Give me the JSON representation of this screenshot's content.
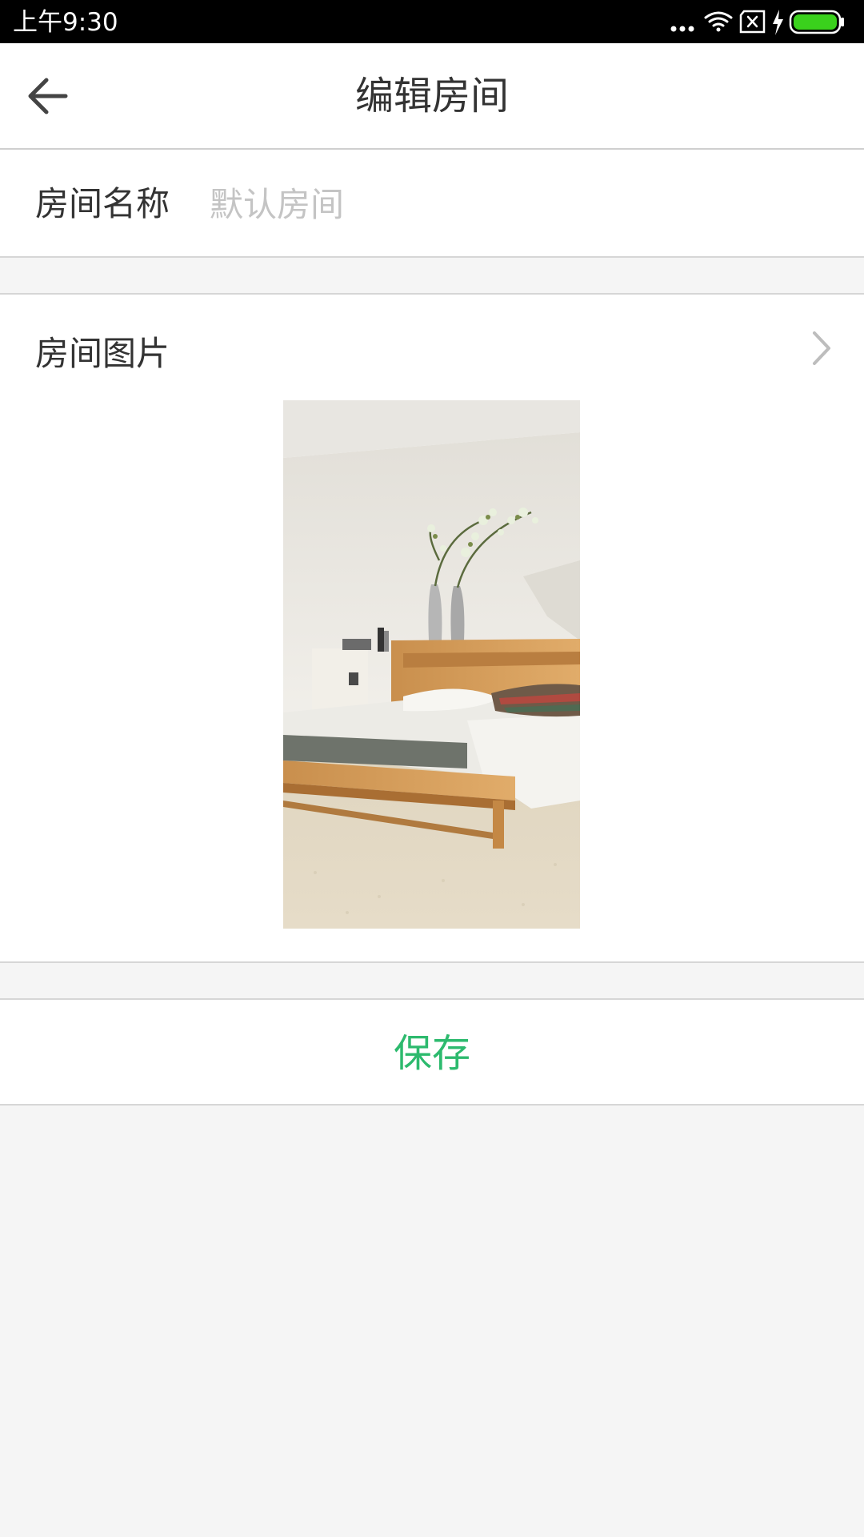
{
  "status_bar": {
    "time": "上午9:30",
    "icons": [
      "more-dots-icon",
      "wifi-icon",
      "sim-card-icon",
      "charging-icon",
      "battery-icon"
    ]
  },
  "app_bar": {
    "back_icon": "arrow-left-icon",
    "title": "编辑房间"
  },
  "room_name": {
    "label": "房间名称",
    "value": "",
    "placeholder": "默认房间"
  },
  "room_image": {
    "label": "房间图片",
    "chevron_icon": "chevron-right-icon"
  },
  "actions": {
    "save_label": "保存"
  },
  "colors": {
    "accent": "#2dba6e",
    "battery": "#3ad11c",
    "background": "#f5f5f5",
    "title_text": "#333333",
    "placeholder": "#c4c4c4"
  }
}
